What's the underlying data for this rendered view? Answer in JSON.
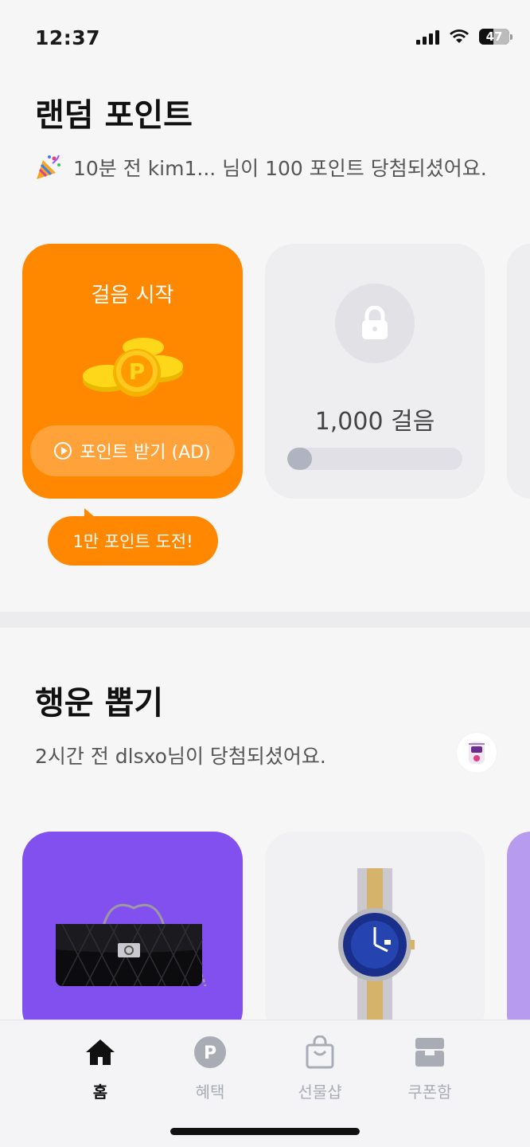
{
  "status": {
    "time": "12:37",
    "battery": "47",
    "battery_level": 0.47
  },
  "random_points": {
    "title": "랜덤 포인트",
    "winner_text": "10분 전 kim1... 님이 100 포인트 당첨되셨어요.",
    "party_icon": "party-popper-icon",
    "card_start": {
      "title": "걸음 시작",
      "button": "포인트 받기 (AD)"
    },
    "card_locked": {
      "steps": "1,000 걸음",
      "progress": 0.14
    },
    "bubble": "1만 포인트 도전!"
  },
  "lucky_draw": {
    "title": "행운 뽑기",
    "winner_text": "2시간 전 dlsxo님이 당첨되셨어요.",
    "colors": {
      "purple": "#8250ee",
      "light_purple": "#b79bee"
    }
  },
  "nav": {
    "items": [
      {
        "label": "홈",
        "icon": "home-icon",
        "active": true
      },
      {
        "label": "혜택",
        "icon": "point-coin-icon",
        "active": false
      },
      {
        "label": "선물샵",
        "icon": "shopping-bag-icon",
        "active": false
      },
      {
        "label": "쿠폰함",
        "icon": "coupon-box-icon",
        "active": false
      }
    ]
  },
  "colors": {
    "accent": "#ff8800",
    "accent_light": "#ffa23a",
    "inactive": "#a9acb5"
  }
}
